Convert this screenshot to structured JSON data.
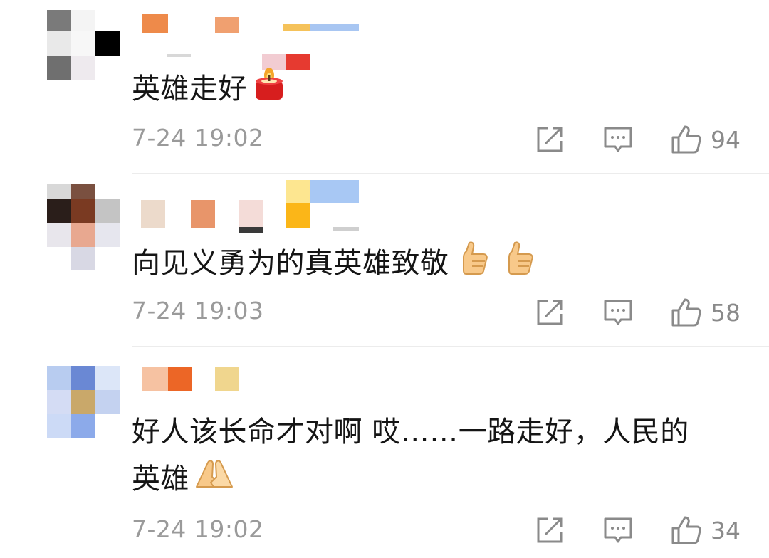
{
  "comments": [
    {
      "text": "英雄走好",
      "emoji": "candle-emoji",
      "time": "7-24 19:02",
      "likes": "94"
    },
    {
      "text": "向见义勇为的真英雄致敬",
      "emoji": "thumbs-up-emoji",
      "time": "7-24 19:03",
      "likes": "58"
    },
    {
      "text_line1": "好人该长命才对啊 哎……一路走好，人民的",
      "text_line2": "英雄",
      "emoji": "pray-hands-emoji",
      "time": "7-24 19:02",
      "likes": "34"
    }
  ],
  "icons": {
    "share": "share-icon",
    "comment": "comment-icon",
    "like": "like-icon"
  },
  "colors": {
    "text": "#151515",
    "meta": "#9a9a9a",
    "icon": "#8a8a8a",
    "divider": "#ececec"
  }
}
